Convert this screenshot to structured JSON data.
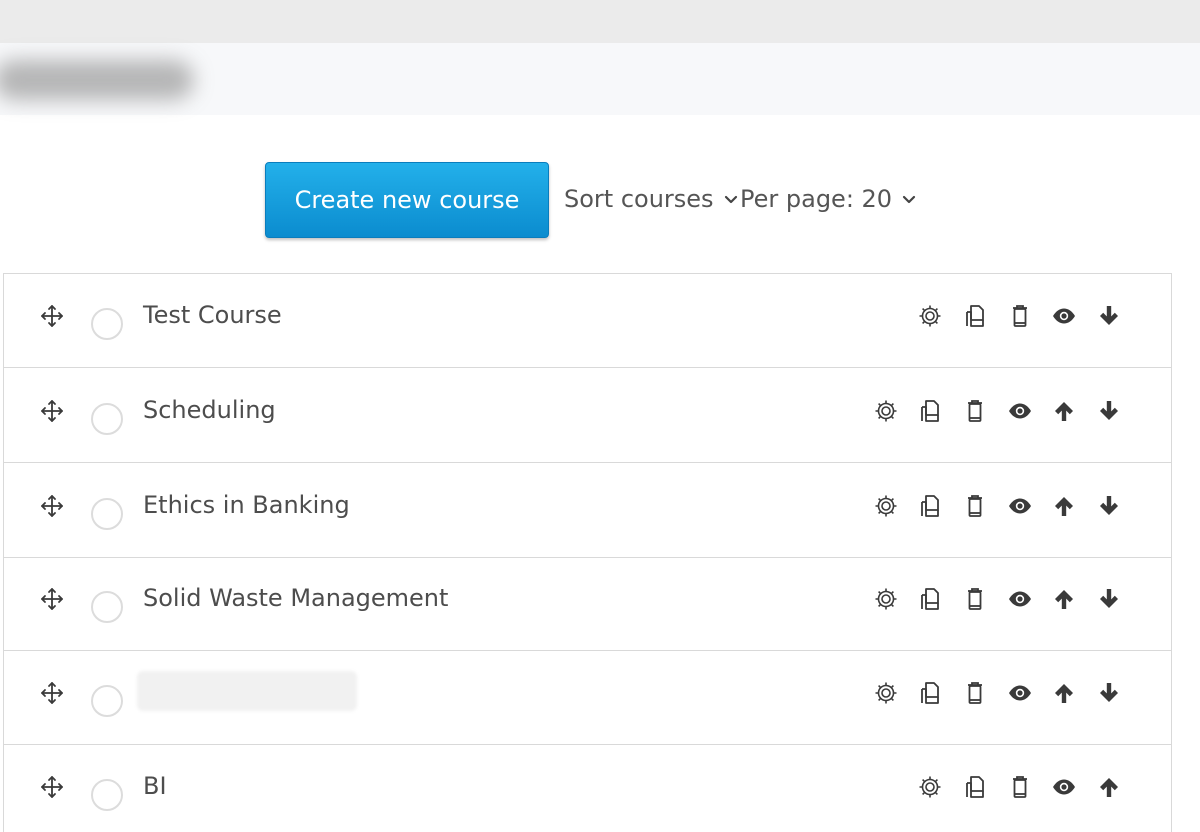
{
  "toolbar": {
    "create_label": "Create new course",
    "sort_label": "Sort courses",
    "per_page_label": "Per page: 20"
  },
  "courses": [
    {
      "name": "Test Course",
      "actions": [
        "gear-icon",
        "copy-icon",
        "delete-icon",
        "eye-icon",
        "arrow-down-icon"
      ]
    },
    {
      "name": "Scheduling",
      "actions": [
        "gear-icon",
        "copy-icon",
        "delete-icon",
        "eye-icon",
        "arrow-up-icon",
        "arrow-down-icon"
      ]
    },
    {
      "name": "Ethics in Banking",
      "actions": [
        "gear-icon",
        "copy-icon",
        "delete-icon",
        "eye-icon",
        "arrow-up-icon",
        "arrow-down-icon"
      ]
    },
    {
      "name": "Solid Waste Management",
      "actions": [
        "gear-icon",
        "copy-icon",
        "delete-icon",
        "eye-icon",
        "arrow-up-icon",
        "arrow-down-icon"
      ]
    },
    {
      "name": "",
      "actions": [
        "gear-icon",
        "copy-icon",
        "delete-icon",
        "eye-icon",
        "arrow-up-icon",
        "arrow-down-icon"
      ]
    },
    {
      "name": "BI",
      "actions": [
        "gear-icon",
        "copy-icon",
        "delete-icon",
        "eye-icon",
        "arrow-up-icon"
      ]
    }
  ],
  "colors": {
    "accent": "#1aa3e0",
    "icon": "#3a3a3a",
    "border": "#d9d9d9"
  }
}
